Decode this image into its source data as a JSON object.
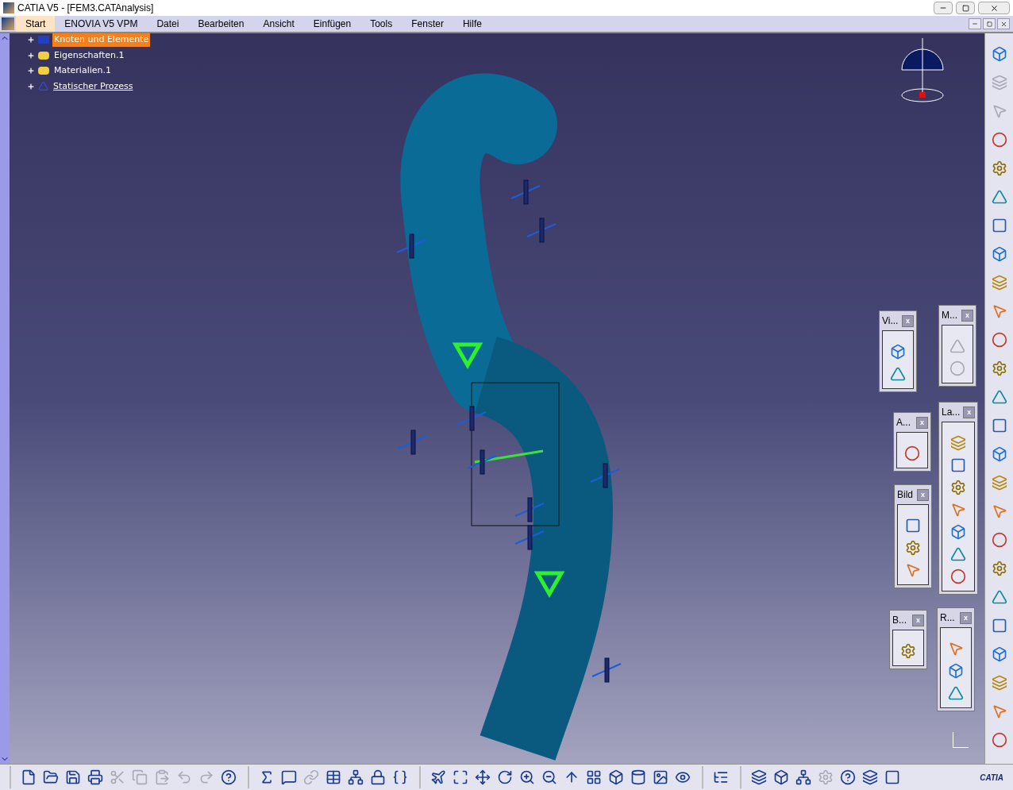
{
  "window": {
    "title": "CATIA V5 - [FEM3.CATAnalysis]"
  },
  "menu": [
    {
      "label": "Start",
      "selected": true
    },
    {
      "label": "ENOVIA V5 VPM",
      "selected": false
    },
    {
      "label": "Datei",
      "selected": false
    },
    {
      "label": "Bearbeiten",
      "selected": false
    },
    {
      "label": "Ansicht",
      "selected": false
    },
    {
      "label": "Einfügen",
      "selected": false
    },
    {
      "label": "Tools",
      "selected": false
    },
    {
      "label": "Fenster",
      "selected": false
    },
    {
      "label": "Hilfe",
      "selected": false
    }
  ],
  "tree": [
    {
      "label": "Knoten und Elemente",
      "selected": true,
      "kind": "mesh"
    },
    {
      "label": "Eigenschaften.1",
      "selected": false,
      "kind": "folder"
    },
    {
      "label": "Materialien.1",
      "selected": false,
      "kind": "folder"
    },
    {
      "label": "Statischer Prozess",
      "selected": false,
      "kind": "process"
    }
  ],
  "floating_toolbars": [
    {
      "title": "Vi...",
      "close": "x",
      "tools": [
        {
          "disabled": false
        },
        {
          "disabled": false
        }
      ]
    },
    {
      "title": "M...",
      "close": "x",
      "tools": [
        {
          "disabled": true
        },
        {
          "disabled": true
        }
      ]
    },
    {
      "title": "A...",
      "close": "x",
      "tools": [
        {
          "disabled": false
        }
      ]
    },
    {
      "title": "La...",
      "close": "x",
      "tools": [
        {
          "disabled": false
        },
        {
          "disabled": false
        },
        {
          "disabled": false
        },
        {
          "disabled": false
        },
        {
          "disabled": false
        },
        {
          "disabled": false
        },
        {
          "disabled": false
        }
      ]
    },
    {
      "title": "Bild",
      "close": "x",
      "tools": [
        {
          "disabled": false
        },
        {
          "disabled": false
        },
        {
          "disabled": false
        }
      ]
    },
    {
      "title": "B...",
      "close": "x",
      "tools": [
        {
          "disabled": false
        }
      ]
    },
    {
      "title": "R...",
      "close": "x",
      "tools": [
        {
          "disabled": false
        },
        {
          "disabled": false
        },
        {
          "disabled": false
        }
      ]
    }
  ],
  "side_toolbar": [
    {
      "disabled": false
    },
    {
      "disabled": true
    },
    {
      "disabled": true
    },
    {
      "disabled": false
    },
    {
      "disabled": false
    },
    {
      "disabled": false
    },
    {
      "disabled": false
    },
    {
      "disabled": false
    },
    {
      "disabled": false
    },
    {
      "disabled": false
    },
    {
      "disabled": false
    },
    {
      "disabled": false
    },
    {
      "disabled": false
    },
    {
      "disabled": false
    },
    {
      "disabled": false
    },
    {
      "disabled": false
    },
    {
      "disabled": false
    },
    {
      "disabled": false
    },
    {
      "disabled": false
    },
    {
      "disabled": false
    },
    {
      "disabled": false
    },
    {
      "disabled": false
    },
    {
      "disabled": false
    },
    {
      "disabled": false
    },
    {
      "disabled": false
    }
  ],
  "bottom_toolbar": [
    [
      {
        "disabled": false
      },
      {
        "disabled": false
      },
      {
        "disabled": false
      },
      {
        "disabled": false
      },
      {
        "disabled": true
      },
      {
        "disabled": true
      },
      {
        "disabled": true
      },
      {
        "disabled": true
      },
      {
        "disabled": true
      },
      {
        "disabled": false
      }
    ],
    [
      {
        "disabled": false
      },
      {
        "disabled": false
      },
      {
        "disabled": true
      },
      {
        "disabled": false
      },
      {
        "disabled": false
      },
      {
        "disabled": false
      },
      {
        "disabled": false
      }
    ],
    [
      {
        "disabled": false
      },
      {
        "disabled": false
      },
      {
        "disabled": false
      },
      {
        "disabled": false
      },
      {
        "disabled": false
      },
      {
        "disabled": false
      },
      {
        "disabled": false
      },
      {
        "disabled": false
      },
      {
        "disabled": false
      },
      {
        "disabled": false
      },
      {
        "disabled": false
      },
      {
        "disabled": false
      }
    ],
    [
      {
        "disabled": false
      }
    ],
    [
      {
        "disabled": false
      },
      {
        "disabled": false
      },
      {
        "disabled": false
      },
      {
        "disabled": true
      },
      {
        "disabled": false
      },
      {
        "disabled": false
      },
      {
        "disabled": false
      }
    ]
  ],
  "logo": {
    "text": "CATIA"
  }
}
